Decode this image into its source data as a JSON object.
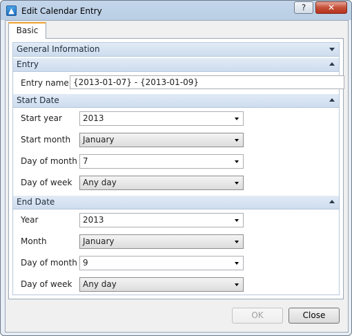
{
  "window": {
    "title": "Edit Calendar Entry",
    "help_label": "?",
    "close_label": "✕"
  },
  "tabs": [
    {
      "label": "Basic"
    }
  ],
  "sections": {
    "general": {
      "label": "General Information"
    },
    "entry": {
      "label": "Entry",
      "name_label": "Entry name",
      "name_value": "{2013-01-07} - {2013-01-09}"
    },
    "start": {
      "label": "Start Date",
      "fields": [
        {
          "label": "Start year",
          "value": "2013"
        },
        {
          "label": "Start month",
          "value": "January"
        },
        {
          "label": "Day of month",
          "value": "7"
        },
        {
          "label": "Day of week",
          "value": "Any day"
        }
      ]
    },
    "end": {
      "label": "End Date",
      "fields": [
        {
          "label": "Year",
          "value": "2013"
        },
        {
          "label": "Month",
          "value": "January"
        },
        {
          "label": "Day of month",
          "value": "9"
        },
        {
          "label": "Day of week",
          "value": "Any day"
        }
      ]
    }
  },
  "buttons": {
    "ok": "OK",
    "close": "Close"
  }
}
